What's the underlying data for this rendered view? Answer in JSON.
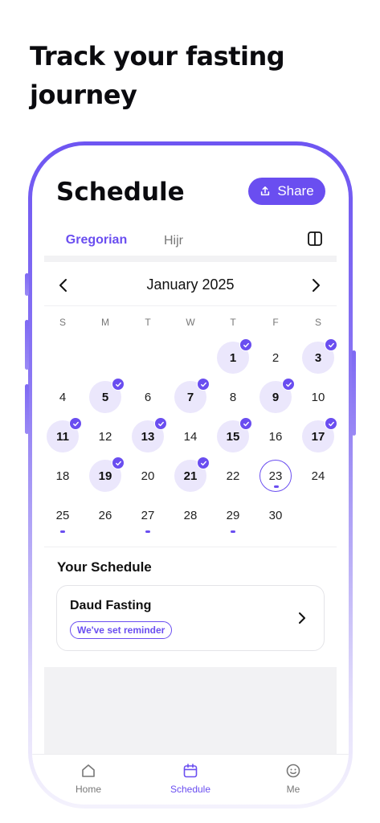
{
  "headline": "Track your fasting journey",
  "screen": {
    "title": "Schedule",
    "share_label": "Share",
    "tabs": [
      {
        "label": "Gregorian",
        "active": true
      },
      {
        "label": "Hijr",
        "active": false
      }
    ]
  },
  "calendar": {
    "month_label": "January 2025",
    "weekdays": [
      "S",
      "M",
      "T",
      "W",
      "T",
      "F",
      "S"
    ],
    "weeks": [
      [
        null,
        null,
        null,
        null,
        {
          "d": "1",
          "s": "fasted"
        },
        {
          "d": "2"
        },
        {
          "d": "3",
          "s": "fasted"
        }
      ],
      [
        {
          "d": "4"
        },
        {
          "d": "5",
          "s": "fasted"
        },
        {
          "d": "6"
        },
        {
          "d": "7",
          "s": "fasted"
        },
        {
          "d": "8"
        },
        {
          "d": "9",
          "s": "fasted"
        },
        {
          "d": "10"
        }
      ],
      [
        {
          "d": "11",
          "s": "fasted"
        },
        {
          "d": "12"
        },
        {
          "d": "13",
          "s": "fasted"
        },
        {
          "d": "14"
        },
        {
          "d": "15",
          "s": "fasted"
        },
        {
          "d": "16"
        },
        {
          "d": "17",
          "s": "fasted"
        }
      ],
      [
        {
          "d": "18"
        },
        {
          "d": "19",
          "s": "fasted"
        },
        {
          "d": "20"
        },
        {
          "d": "21",
          "s": "fasted"
        },
        {
          "d": "22"
        },
        {
          "d": "23",
          "s": "today"
        },
        {
          "d": "24"
        }
      ],
      [
        {
          "d": "25",
          "s": "planned"
        },
        {
          "d": "26"
        },
        {
          "d": "27",
          "s": "planned"
        },
        {
          "d": "28"
        },
        {
          "d": "29",
          "s": "planned"
        },
        {
          "d": "30"
        },
        null
      ]
    ]
  },
  "your_schedule": {
    "title": "Your Schedule",
    "item_name": "Daud Fasting",
    "badge": "We've set reminder"
  },
  "bottom_nav": [
    {
      "label": "Home",
      "icon": "home-icon",
      "active": false
    },
    {
      "label": "Schedule",
      "icon": "calendar-icon",
      "active": true
    },
    {
      "label": "Me",
      "icon": "smiley-icon",
      "active": false
    }
  ],
  "colors": {
    "accent": "#6a4ef0",
    "fasted_bg": "#ebe7fc",
    "panel_bg": "#f2f2f4"
  }
}
